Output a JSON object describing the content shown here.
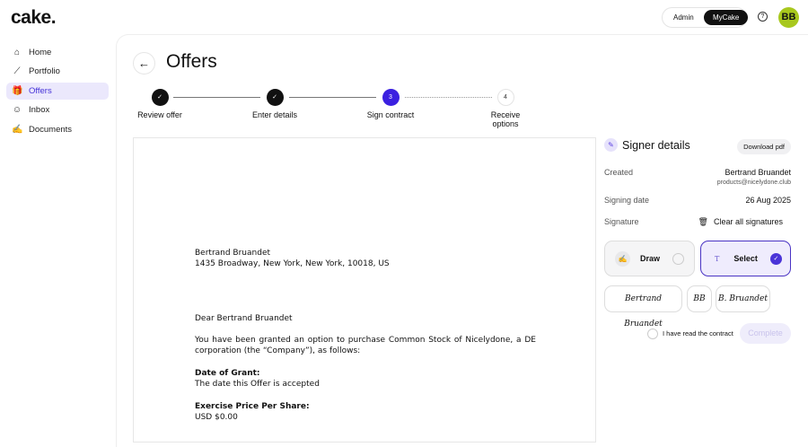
{
  "header": {
    "logo": "cake.",
    "switch": [
      "Admin",
      "MyCake"
    ],
    "help_icon": "?",
    "avatar": "BB"
  },
  "sidebar": {
    "items": [
      {
        "label": "Home",
        "icon": "⌂"
      },
      {
        "label": "Portfolio",
        "icon": "⟋"
      },
      {
        "label": "Offers",
        "icon": "🎁"
      },
      {
        "label": "Inbox",
        "icon": "☺"
      },
      {
        "label": "Documents",
        "icon": "✍"
      }
    ]
  },
  "page": {
    "title": "Offers",
    "back_icon": "←"
  },
  "steps": [
    {
      "label": "Review offer",
      "mark": "✓"
    },
    {
      "label": "Enter details",
      "mark": "✓"
    },
    {
      "label": "Sign contract",
      "mark": "3"
    },
    {
      "label": "Receive options",
      "mark": "4"
    }
  ],
  "document": {
    "name": "Bertrand Bruandet",
    "address": "1435 Broadway, New York, New York, 10018, US",
    "greeting": "Dear Bertrand Bruandet",
    "body": "You have been granted an option to purchase Common Stock of Nicelydone, a DE corporation (the “Company”), as follows:",
    "grant_label": "Date of Grant:",
    "grant_value": "The date this Offer is accepted",
    "price_label": "Exercise Price Per Share:",
    "price_value": "USD $0.00"
  },
  "signer": {
    "title": "Signer details",
    "download": "Download pdf",
    "created_label": "Created",
    "created_name": "Bertrand Bruandet",
    "created_email": "products@nicelydone.club",
    "date_label": "Signing date",
    "date_value": "26 Aug 2025",
    "signature_label": "Signature",
    "clear": "Clear all signatures",
    "draw": "Draw",
    "select": "Select",
    "options": [
      "Bertrand Bruandet",
      "BB",
      "B. Bruandet"
    ],
    "read_label": "I have read the contract",
    "complete": "Complete"
  },
  "colors": {
    "accent": "#3b20e0",
    "avatar": "#a8c81e"
  }
}
